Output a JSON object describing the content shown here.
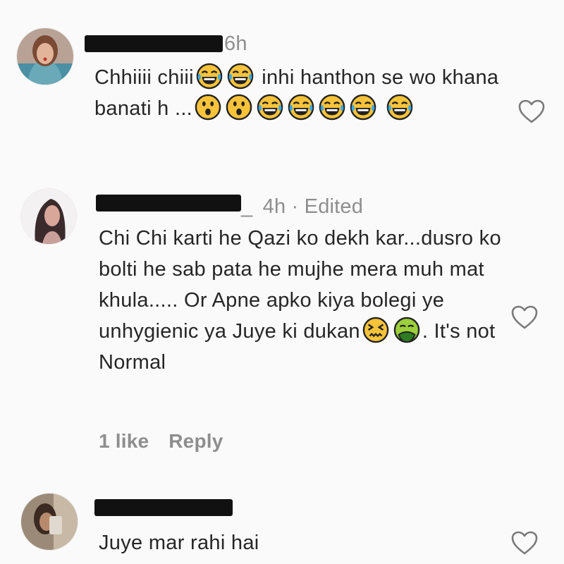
{
  "colors": {
    "text": "#262626",
    "meta": "#8e8e8e",
    "background": "#fafafa"
  },
  "comments": [
    {
      "username": "[redacted]",
      "time": "6h",
      "text_parts": [
        "Chhiiii chiii",
        "inhi hanthon se wo khana banati h ..."
      ],
      "emojis": [
        "face-with-tears-of-joy",
        "face-with-tears-of-joy",
        "astonished-face",
        "astonished-face",
        "face-with-tears-of-joy",
        "face-with-tears-of-joy",
        "face-with-tears-of-joy",
        "face-with-tears-of-joy",
        "face-with-tears-of-joy"
      ],
      "like_icon": "heart-outline-icon"
    },
    {
      "username": "[redacted]",
      "username_tail": "_",
      "time": "4h",
      "edited": "· Edited",
      "text_parts": [
        "Chi Chi karti he Qazi ko dekh kar...dusro ko bolti he sab pata he mujhe mera muh mat khula..... Or Apne apko kiya bolegi ye unhygienic ya Juye ki dukan",
        ". It's not Normal"
      ],
      "emojis": [
        "confounded-face",
        "nauseated-face"
      ],
      "likes": "1 like",
      "reply": "Reply",
      "like_icon": "heart-outline-icon"
    },
    {
      "username": "[redacted]",
      "text_parts": [
        "Juye mar rahi hai"
      ],
      "like_icon": "heart-outline-icon"
    }
  ]
}
